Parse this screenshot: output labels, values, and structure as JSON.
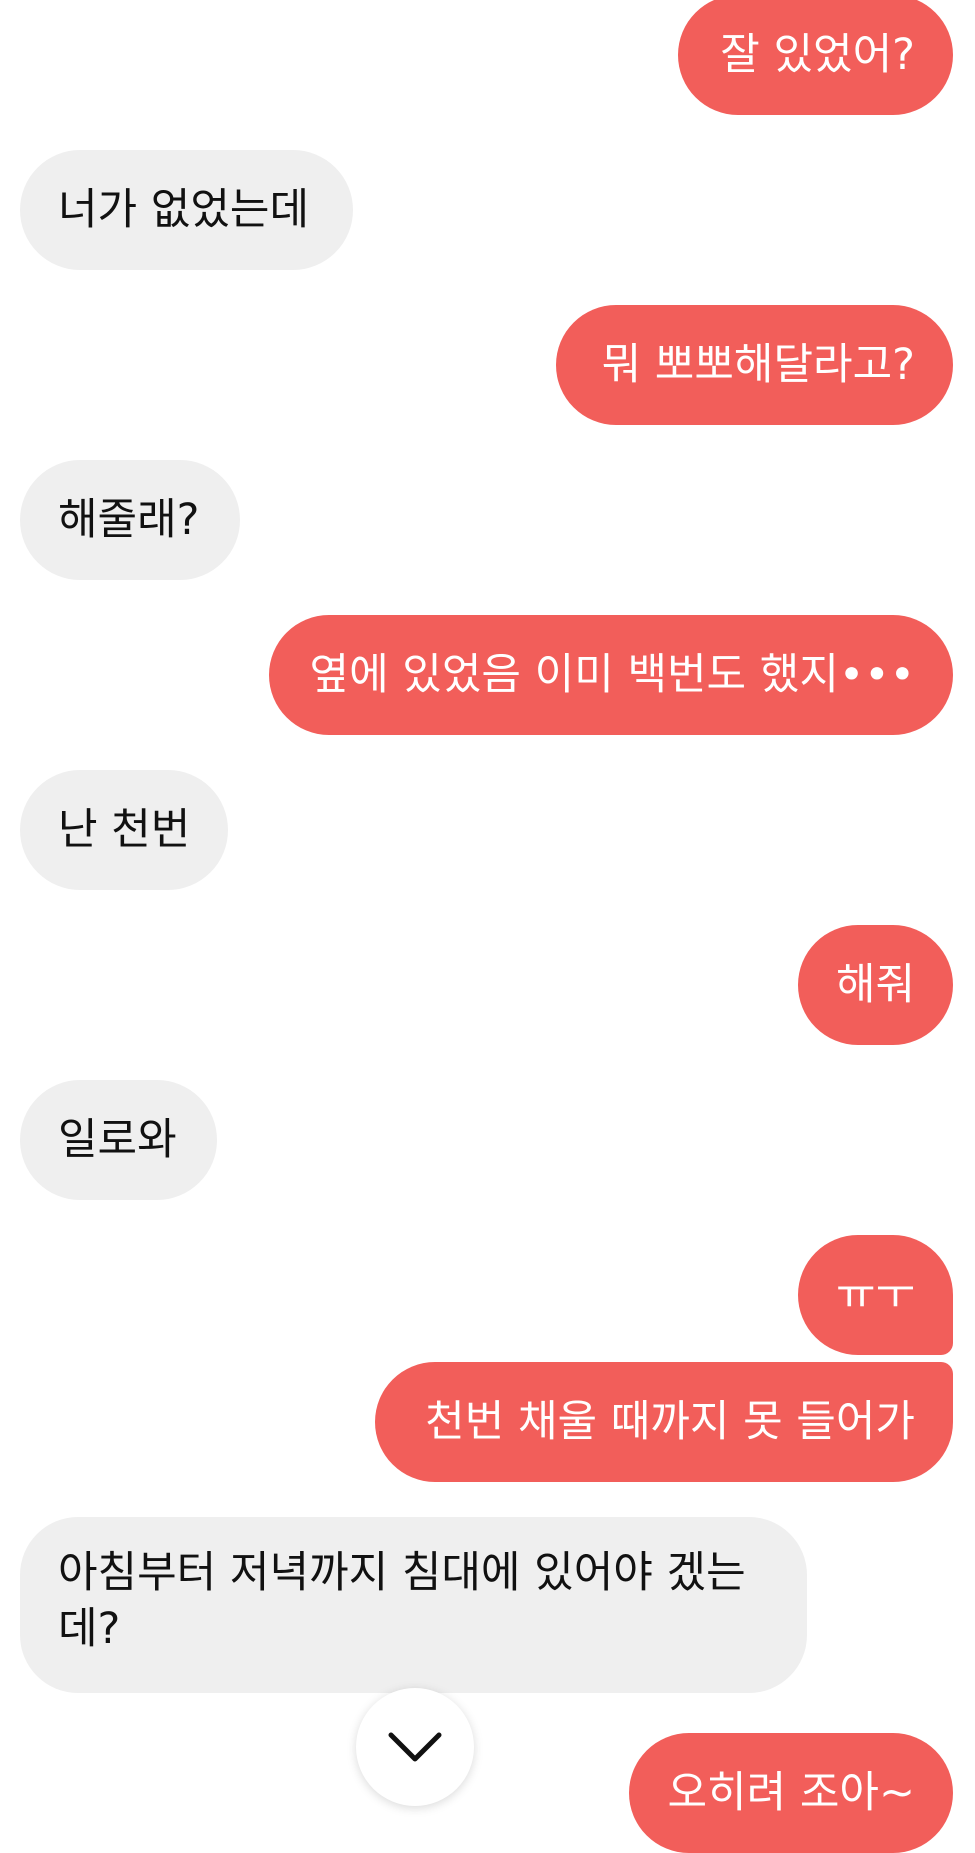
{
  "messages": [
    {
      "side": "out",
      "text": "잘 있었어?"
    },
    {
      "side": "in",
      "text": "너가 없었는데"
    },
    {
      "side": "out",
      "text": "뭐 뽀뽀해달라고?"
    },
    {
      "side": "in",
      "text": "해줄래?"
    },
    {
      "side": "out",
      "text": "옆에 있었음 이미 백번도 했지•••"
    },
    {
      "side": "in",
      "text": "난 천번"
    },
    {
      "side": "out",
      "text": "해줘"
    },
    {
      "side": "in",
      "text": "일로와"
    },
    {
      "side": "out",
      "text": "ㅠㅜ"
    },
    {
      "side": "out",
      "text": "천번 채울 때까지 못 들어가"
    },
    {
      "side": "in",
      "text": "아침부터 저녁까지 침대에 있어야 겠는데?"
    },
    {
      "side": "out",
      "text": "오히려 조아~"
    }
  ],
  "scroll_button": {
    "icon": "chevron-down-icon"
  },
  "colors": {
    "outgoing_bubble": "#f25e5a",
    "incoming_bubble": "#efefef",
    "outgoing_text": "#ffffff",
    "incoming_text": "#111111"
  }
}
